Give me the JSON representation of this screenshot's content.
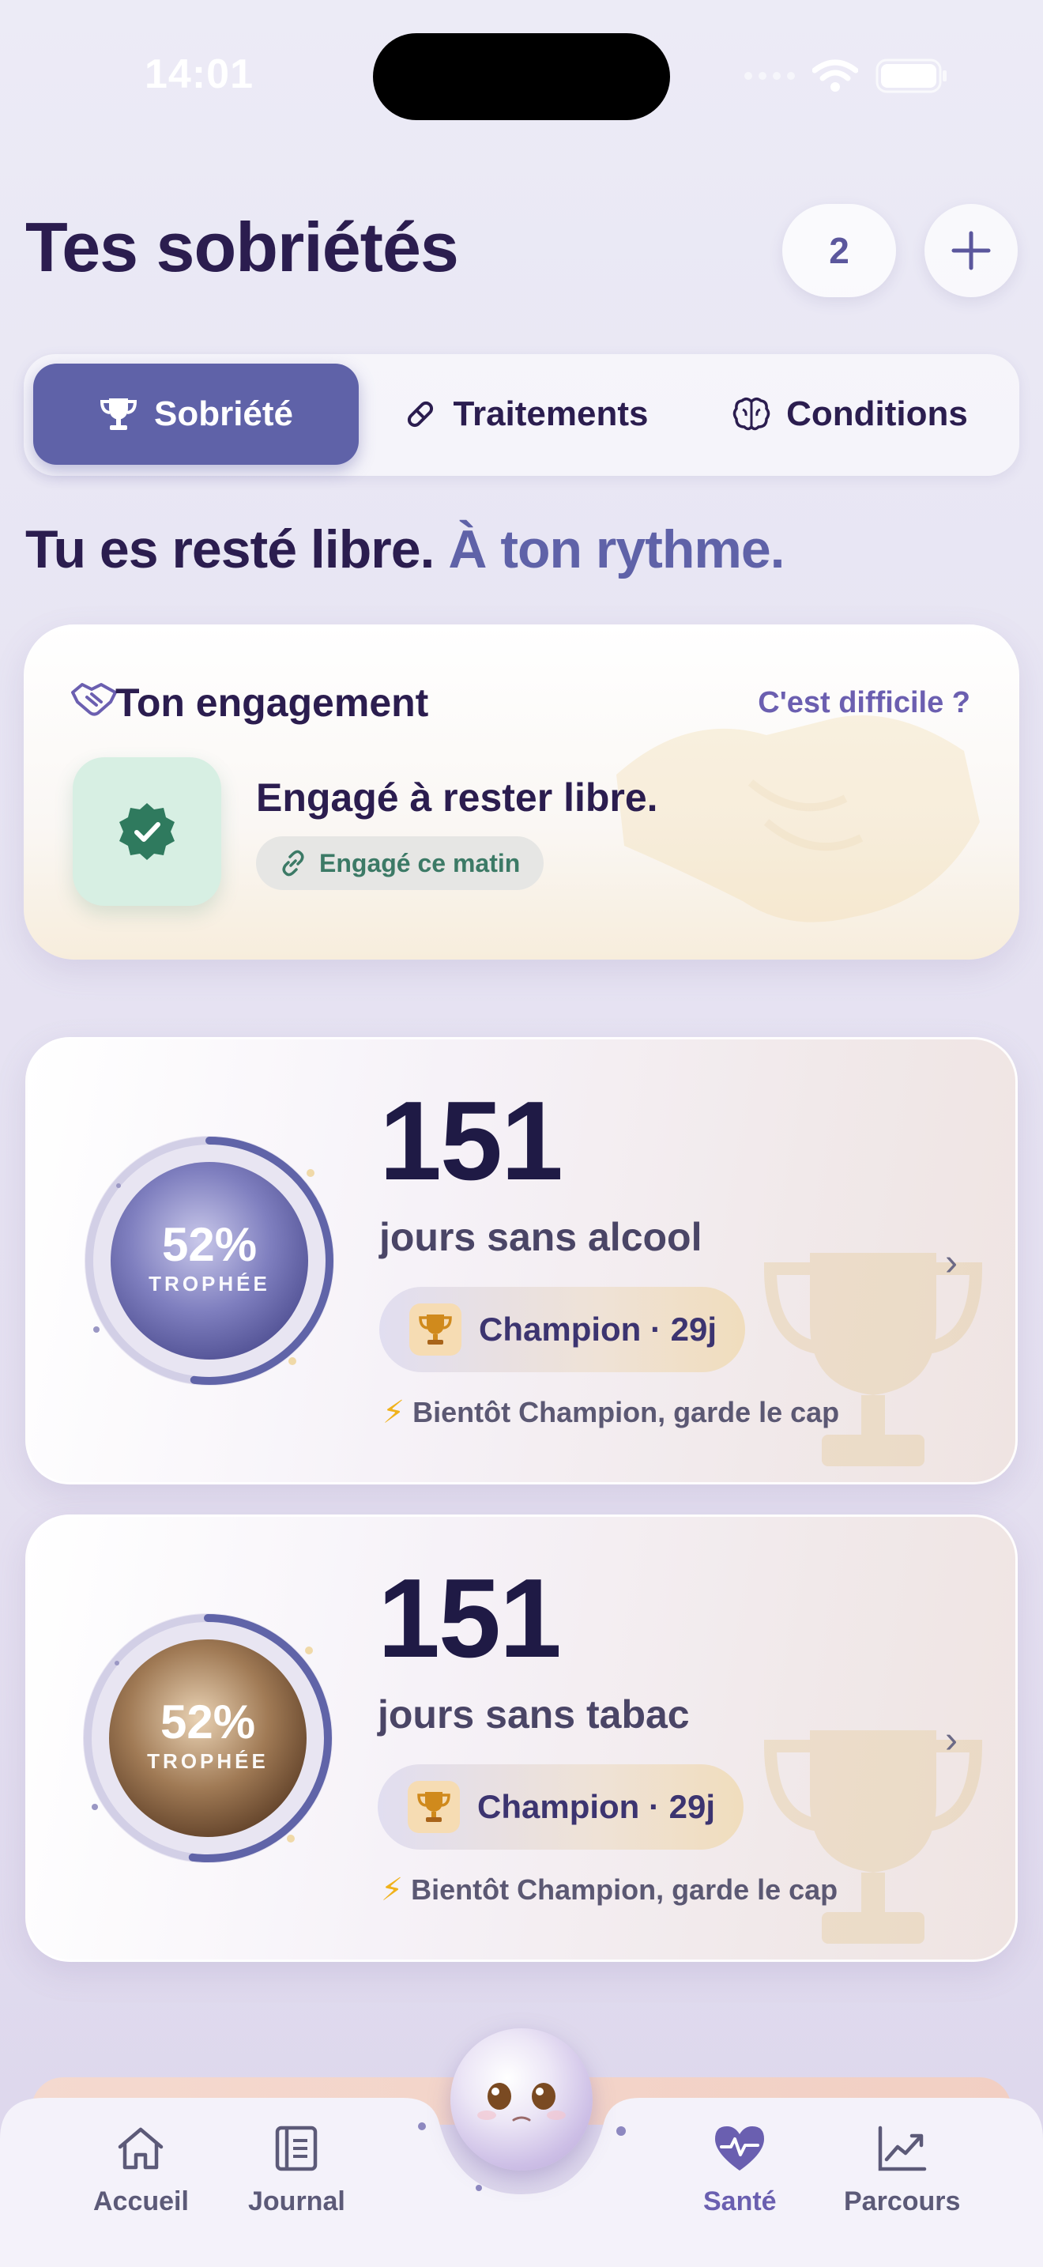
{
  "status_bar": {
    "time": "14:01"
  },
  "header": {
    "title": "Tes sobriétés",
    "count": "2",
    "add_label": "+"
  },
  "tabs": [
    {
      "label": "Sobriété",
      "icon": "trophy-icon",
      "active": true
    },
    {
      "label": "Traitements",
      "icon": "pill-icon",
      "active": false
    },
    {
      "label": "Conditions",
      "icon": "brain-icon",
      "active": false
    }
  ],
  "subtitle": {
    "main": "Tu es resté libre.",
    "accent": "À ton rythme."
  },
  "engagement": {
    "title": "Ton engagement",
    "help_link": "C'est difficile ?",
    "statement": "Engagé à rester libre.",
    "badge": "Engagé ce matin",
    "accent_color": "#3c7a66"
  },
  "streaks": [
    {
      "days": "151",
      "label": "jours sans alcool",
      "progress_pct": "52%",
      "progress_value": 0.52,
      "progress_label": "TROPHÉE",
      "trophy": "Champion · 29j",
      "hint": "Bientôt Champion, garde le cap",
      "orb_color": "#6f6fb3"
    },
    {
      "days": "151",
      "label": "jours sans tabac",
      "progress_pct": "52%",
      "progress_value": 0.52,
      "progress_label": "TROPHÉE",
      "trophy": "Champion · 29j",
      "hint": "Bientôt Champion, garde le cap",
      "orb_color": "#8a6a4c"
    }
  ],
  "nav": [
    {
      "label": "Accueil",
      "icon": "home-icon",
      "active": false
    },
    {
      "label": "Journal",
      "icon": "journal-icon",
      "active": false
    },
    {
      "label": "Santé",
      "icon": "heart-pulse-icon",
      "active": true
    },
    {
      "label": "Parcours",
      "icon": "chart-trend-icon",
      "active": false
    }
  ],
  "colors": {
    "accent": "#5f62a8",
    "title": "#2b1d4f"
  }
}
